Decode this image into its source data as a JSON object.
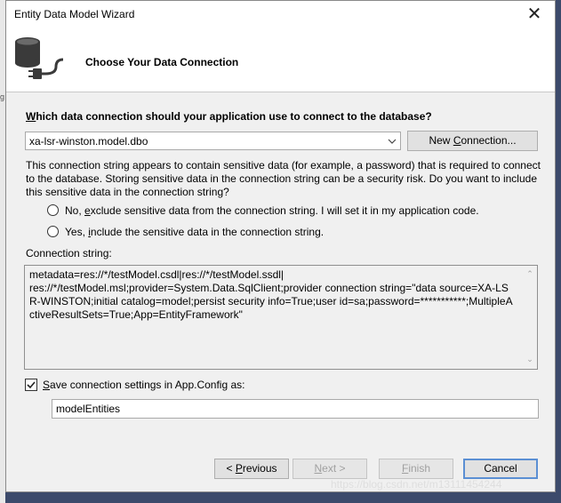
{
  "window": {
    "title": "Entity Data Model Wizard",
    "close_glyph": "✕"
  },
  "header": {
    "title": "Choose Your Data Connection",
    "icon": "database-connection-icon"
  },
  "question": {
    "prefix": "W",
    "rest": "hich data connection should your application use to connect to the database?"
  },
  "connection_select": {
    "value": "xa-lsr-winston.model.dbo"
  },
  "new_connection_button": {
    "before": "New ",
    "underlined": "C",
    "after": "onnection..."
  },
  "sensitive_notice": "This connection string appears to contain sensitive data (for example, a password) that is required to connect to the database. Storing sensitive data in the connection string can be a security risk. Do you want to include this sensitive data in the connection string?",
  "radio_exclude": {
    "before": "No, ",
    "underlined": "e",
    "after": "xclude sensitive data from the connection string. I will set it in my application code."
  },
  "radio_include": {
    "before": "Yes, ",
    "underlined": "i",
    "after": "nclude the sensitive data in the connection string."
  },
  "connection_string": {
    "label": "Connection string:",
    "value": "metadata=res://*/testModel.csdl|res://*/testModel.ssdl|\nres://*/testModel.msl;provider=System.Data.SqlClient;provider connection string=\"data source=XA-LSR-WINSTON;initial catalog=model;persist security info=True;user id=sa;password=***********;MultipleActiveResultSets=True;App=EntityFramework\""
  },
  "save_settings": {
    "checked": true,
    "underlined": "S",
    "after": "ave connection settings in App.Config as:"
  },
  "entity_name": {
    "value": "modelEntities"
  },
  "nav_buttons": {
    "previous_before": "< ",
    "previous_underlined": "P",
    "previous_after": "revious",
    "next_underlined": "N",
    "next_after": "ext >",
    "finish_underlined": "F",
    "finish_after": "inish",
    "cancel": "Cancel"
  },
  "left_edge_mark": "g",
  "watermark": "https://blog.csdn.net/m13111454244"
}
